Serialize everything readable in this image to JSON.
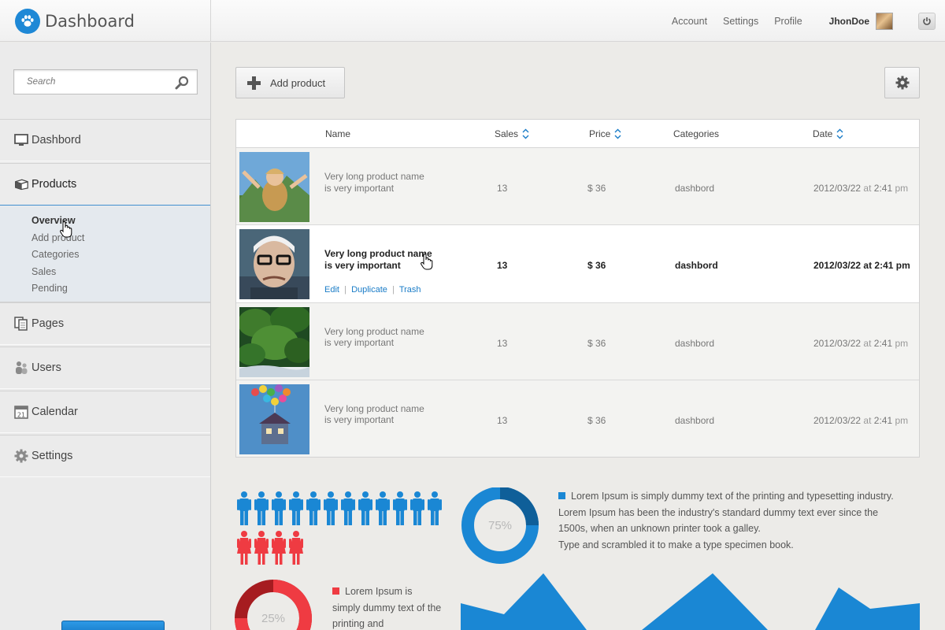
{
  "header": {
    "app_title": "Dashboard",
    "nav": [
      "Account",
      "Settings",
      "Profile"
    ],
    "username": "JhonDoe"
  },
  "sidebar": {
    "search_placeholder": "Search",
    "items": [
      {
        "label": "Dashbord",
        "icon": "monitor-icon"
      },
      {
        "label": "Products",
        "icon": "box-icon"
      },
      {
        "label": "Pages",
        "icon": "pages-icon"
      },
      {
        "label": "Users",
        "icon": "users-icon"
      },
      {
        "label": "Calendar",
        "icon": "calendar-icon"
      },
      {
        "label": "Settings",
        "icon": "gear-icon"
      }
    ],
    "subitems": [
      "Overview",
      "Add product",
      "Categories",
      "Sales",
      "Pending"
    ],
    "calendar_icon_day": "21"
  },
  "toolbar": {
    "add_label": "Add product"
  },
  "table": {
    "headers": {
      "name": "Name",
      "sales": "Sales",
      "price": "Price",
      "categories": "Categories",
      "date": "Date"
    },
    "rows": [
      {
        "name_line1": "Very long product name",
        "name_line2": "is very important",
        "sales": "13",
        "price": "$ 36",
        "category": "dashbord",
        "date": "2012/03/22",
        "at": "at",
        "time": "2:41",
        "ampm": "pm"
      },
      {
        "name_line1": "Very long product name",
        "name_line2": "is very important",
        "sales": "13",
        "price": "$ 36",
        "category": "dashbord",
        "date": "2012/03/22",
        "at": "at",
        "time": "2:41",
        "ampm": "pm"
      },
      {
        "name_line1": "Very long product name",
        "name_line2": "is very important",
        "sales": "13",
        "price": "$ 36",
        "category": "dashbord",
        "date": "2012/03/22",
        "at": "at",
        "time": "2:41",
        "ampm": "pm"
      },
      {
        "name_line1": "Very long product name",
        "name_line2": "is very important",
        "sales": "13",
        "price": "$ 36",
        "category": "dashbord",
        "date": "2012/03/22",
        "at": "at",
        "time": "2:41",
        "ampm": "pm"
      }
    ],
    "row_actions": [
      "Edit",
      "Duplicate",
      "Trash"
    ]
  },
  "infographic": {
    "male_count": 12,
    "female_count": 4,
    "blue_pie_label": "75%",
    "blue_pie_value": 0.75,
    "red_pie_label": "25%",
    "red_pie_value": 0.25,
    "blue_text": "Lorem Ipsum is simply dummy text of the printing and typesetting industry. Lorem Ipsum has been the industry's standard dummy text ever since the 1500s, when an unknown printer took a galley.",
    "blue_text_2": "Type and scrambled it to make a type specimen book.",
    "red_text": "Lorem Ipsum is simply dummy text of the printing and",
    "colors": {
      "blue": "#1a87d4",
      "blue_dark": "#0f5f99",
      "red": "#ef3b42",
      "red_dark": "#a61c20",
      "accent": "#1e88d6"
    }
  }
}
